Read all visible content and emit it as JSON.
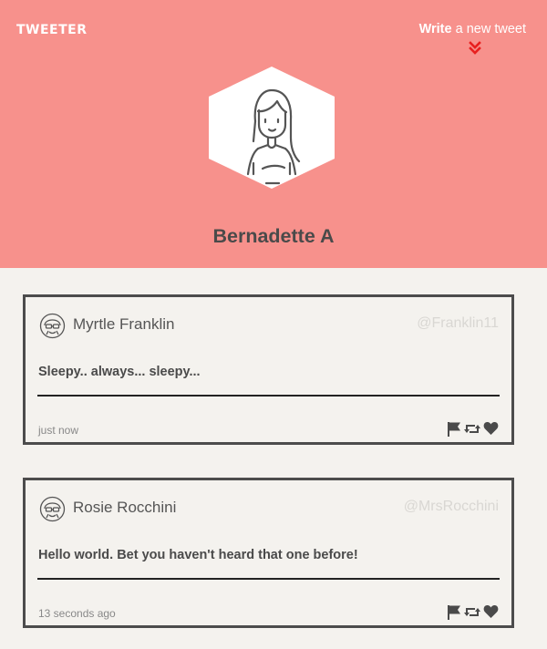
{
  "header": {
    "logo": "TWEETER",
    "compose_strong": "Write",
    "compose_rest": " a new tweet"
  },
  "profile": {
    "name": "Bernadette A"
  },
  "tweets": [
    {
      "author": "Myrtle Franklin",
      "handle": "@Franklin11",
      "text": "Sleepy.. always... sleepy...",
      "time": "just now"
    },
    {
      "author": "Rosie Rocchini",
      "handle": "@MrsRocchini",
      "text": "Hello world. Bet you haven't heard that one before!",
      "time": "13 seconds ago"
    }
  ],
  "icons": {
    "compose_chevron": "double-chevron-down-icon",
    "profile_image": "hexagon-avatar-icon",
    "actions": [
      "flag-icon",
      "retweet-icon",
      "heart-icon"
    ]
  },
  "colors": {
    "header_bg": "#f7918c",
    "accent": "#e8201f",
    "page_bg": "#f4f2ee"
  }
}
